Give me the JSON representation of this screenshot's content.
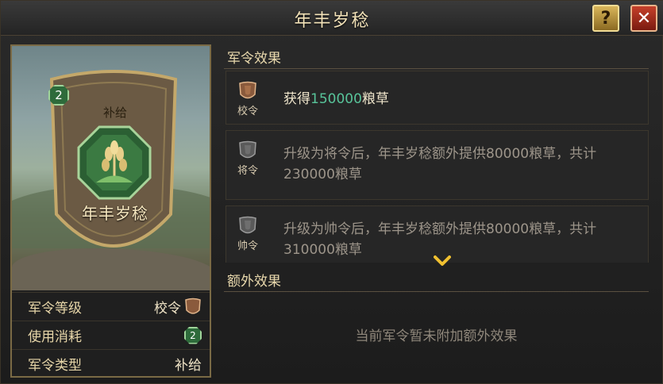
{
  "window": {
    "title": "年丰岁稔"
  },
  "buttons": {
    "help_label": "?",
    "close_label": "✕"
  },
  "card": {
    "tier": "2",
    "type_label": "补给",
    "name": "年丰岁稔",
    "emblem_icon": "wheat-emblem-icon"
  },
  "info": {
    "rows": [
      {
        "key": "军令等级",
        "value": "校令",
        "icon": "bronze-token-icon"
      },
      {
        "key": "使用消耗",
        "value": "2",
        "icon": "green-badge-icon"
      },
      {
        "key": "军令类型",
        "value": "补给"
      }
    ]
  },
  "effects": {
    "title": "军令效果",
    "items": [
      {
        "rank": "校令",
        "pre": "获得",
        "num": "150000",
        "post": "粮草",
        "state": "active"
      },
      {
        "rank": "将令",
        "text": "升级为将令后，年丰岁稔额外提供80000粮草，共计230000粮草",
        "state": "locked"
      },
      {
        "rank": "帅令",
        "text": "升级为帅令后，年丰岁稔额外提供80000粮草，共计310000粮草",
        "state": "locked"
      }
    ]
  },
  "extra": {
    "title": "额外效果",
    "empty_text": "当前军令暂未附加额外效果"
  },
  "colors": {
    "accent_green": "#58c49a",
    "gold": "#c4a86a",
    "close_red": "#c5402a"
  }
}
